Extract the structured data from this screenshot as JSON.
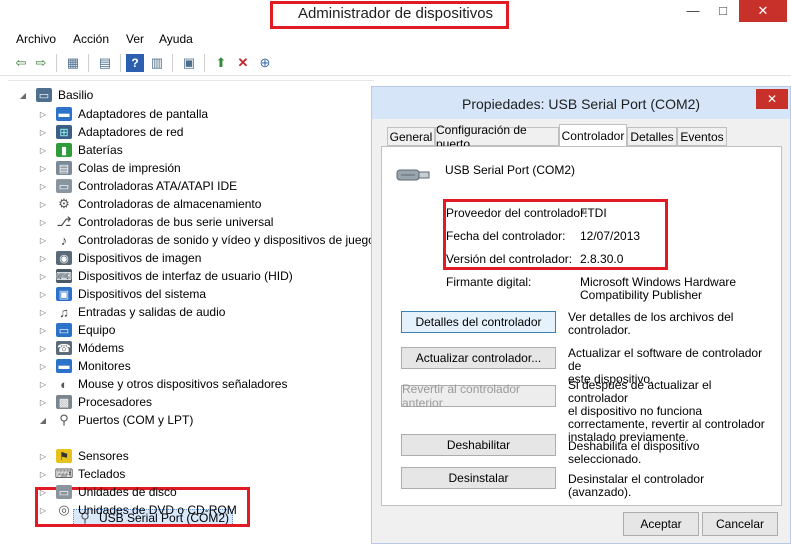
{
  "window": {
    "title": "Administrador de dispositivos",
    "minimize": "—",
    "maximize": "□",
    "close": "✕"
  },
  "menu": [
    "Archivo",
    "Acción",
    "Ver",
    "Ayuda"
  ],
  "tree": {
    "root": "Basilio",
    "items": [
      "Adaptadores de pantalla",
      "Adaptadores de red",
      "Baterías",
      "Colas de impresión",
      "Controladoras ATA/ATAPI IDE",
      "Controladoras de almacenamiento",
      "Controladoras de bus serie universal",
      "Controladoras de sonido y vídeo y dispositivos de juego",
      "Dispositivos de imagen",
      "Dispositivos de interfaz de usuario (HID)",
      "Dispositivos del sistema",
      "Entradas y salidas de audio",
      "Equipo",
      "Módems",
      "Monitores",
      "Mouse y otros dispositivos señaladores",
      "Procesadores",
      "Puertos (COM y LPT)",
      "Sensores",
      "Teclados",
      "Unidades de disco",
      "Unidades de DVD o CD-ROM"
    ],
    "selected_child": "USB Serial Port (COM2)"
  },
  "dialog": {
    "title": "Propiedades: USB Serial Port (COM2)",
    "close": "✕",
    "tabs": [
      "General",
      "Configuración de puerto",
      "Controlador",
      "Detalles",
      "Eventos"
    ],
    "device_name": "USB Serial Port (COM2)",
    "props": {
      "provider_label": "Proveedor del controlador:",
      "provider_value": "FTDI",
      "date_label": "Fecha del controlador:",
      "date_value": "12/07/2013",
      "version_label": "Versión del controlador:",
      "version_value": "2.8.30.0",
      "signer_label": "Firmante digital:",
      "signer_value_1": "Microsoft Windows Hardware",
      "signer_value_2": "Compatibility Publisher"
    },
    "actions": [
      {
        "label": "Detalles del controlador",
        "desc_1": "Ver detalles de los archivos del",
        "desc_2": "controlador.",
        "desc_3": "",
        "desc_4": ""
      },
      {
        "label": "Actualizar controlador...",
        "desc_1": "Actualizar el software de controlador de",
        "desc_2": "este dispositivo.",
        "desc_3": "",
        "desc_4": ""
      },
      {
        "label": "Revertir al controlador anterior",
        "desc_1": "Si después de actualizar el controlador",
        "desc_2": "el dispositivo no funciona",
        "desc_3": "correctamente, revertir al controlador",
        "desc_4": "instalado previamente."
      },
      {
        "label": "Deshabilitar",
        "desc_1": "Deshabilita el dispositivo seleccionado.",
        "desc_2": "",
        "desc_3": "",
        "desc_4": ""
      },
      {
        "label": "Desinstalar",
        "desc_1": "Desinstalar el controlador (avanzado).",
        "desc_2": "",
        "desc_3": "",
        "desc_4": ""
      }
    ],
    "ok": "Aceptar",
    "cancel": "Cancelar"
  }
}
